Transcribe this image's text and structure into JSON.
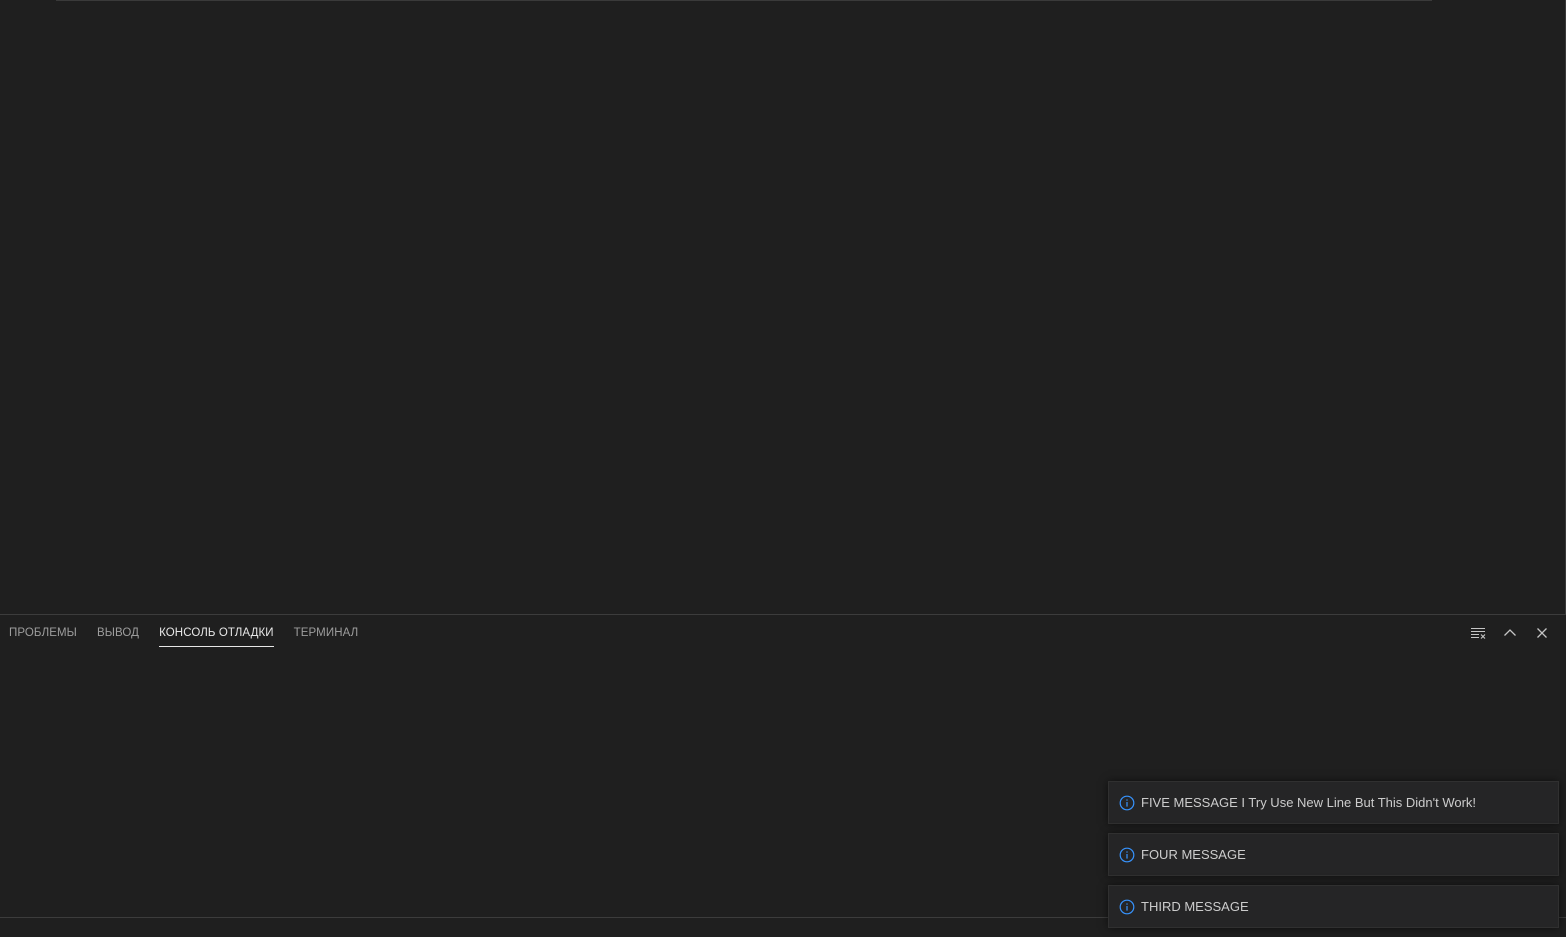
{
  "panel": {
    "tabs": [
      {
        "label": "ПРОБЛЕМЫ",
        "active": false
      },
      {
        "label": "ВЫВОД",
        "active": false
      },
      {
        "label": "КОНСОЛЬ ОТЛАДКИ",
        "active": true
      },
      {
        "label": "ТЕРМИНАЛ",
        "active": false
      }
    ],
    "actions": [
      {
        "icon": "clear-console-icon"
      },
      {
        "icon": "chevron-up-icon"
      },
      {
        "icon": "close-icon"
      }
    ]
  },
  "notifications": [
    {
      "icon": "info-icon",
      "message": "FIVE MESSAGE I Try Use New Line But This Didn't Work!"
    },
    {
      "icon": "info-icon",
      "message": "FOUR MESSAGE"
    },
    {
      "icon": "info-icon",
      "message": "THIRD MESSAGE"
    }
  ],
  "colors": {
    "background": "#1f1f1f",
    "info_accent": "#3794ff",
    "active_tab": "#e7e7e7",
    "inactive_tab": "#9d9d9d"
  }
}
